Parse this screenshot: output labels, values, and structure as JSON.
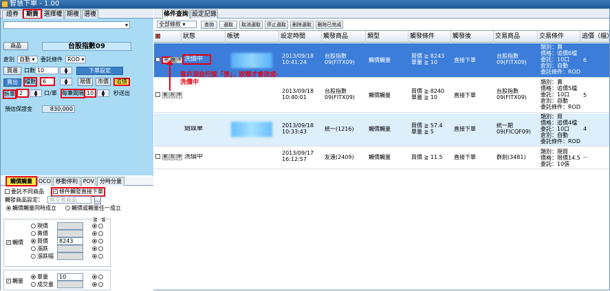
{
  "window": {
    "title": "智慧下單 - 1.00"
  },
  "left_tabs": [
    "證券",
    "期貨",
    "選擇權",
    "期複",
    "選複"
  ],
  "order": {
    "product_button": "商品",
    "product_name": "台股指數09",
    "position_label": "倉別",
    "position_value": "自動",
    "condition_label": "委託條件",
    "condition_value": "ROD",
    "buy_label": "買進",
    "lots_label": "口數",
    "lots_value": "10",
    "place_order": "下單設定",
    "sell_label": "賣出",
    "ticks_label": "檔數",
    "ticks_value": "6",
    "limit_btn": "限價",
    "market_btn": "市價",
    "chase_btn": "追價",
    "split_label": "拆單",
    "split_value": "2",
    "per_lot_label": "口/單",
    "interval_label": "每筆間隔",
    "interval_value": "10",
    "sec_label": "秒送出",
    "margin_label": "預估保證金",
    "margin_value": "830,000"
  },
  "cond_tabs": [
    "觸價觸量",
    "OCO",
    "移動停利",
    "POV",
    "分時分量"
  ],
  "cond": {
    "diff_product": "委託不同商品",
    "direct_order": "條件觸發直接下單",
    "trigger_product_label": "觸發商品設定：",
    "trigger_product_value": "與交易商品",
    "radio_all": "觸價觸量同時成立",
    "radio_any": "觸價或觸量任一成立",
    "price_check": "觸價",
    "price_opts": [
      "現價",
      "賣價",
      "買價",
      "漲跌",
      "漲跌幅"
    ],
    "price_value": "8243",
    "vol_check": "觸量",
    "vol_opts": [
      "單量",
      "成交量"
    ],
    "vol_value": "10",
    "ge": "≧",
    "le": "≦"
  },
  "right_tabs": [
    "條件查詢",
    "設定記錄"
  ],
  "toolbar": {
    "filter": "全部條款",
    "query": "查詢",
    "select": "選取",
    "cancel_select": "取消選取",
    "stop_select": "停止選取",
    "delete_select": "刪除選取",
    "delete_done": "刪除已完成"
  },
  "columns": [
    "狀態",
    "帳號",
    "設定時間",
    "觸發商品",
    "類型",
    "觸發條件",
    "觸發後",
    "交易商品",
    "交易條件",
    "追價（檔）"
  ],
  "rows": [
    {
      "status": "洗價中",
      "time": "2013/09/18 10:41:24",
      "trig_prod": "台股指數 09(FITX09)",
      "type": "觸價觸量",
      "cond": "買價 ≧ 8243\n單量 ≧ 10",
      "after": "直接下單",
      "trade_prod": "台股指數 09(FITX09)",
      "trade_cond": "類別：賣\n價格：追價6檔\n委託：10口\n倉別：自動\n委託條件：ROD",
      "chase": "6"
    },
    {
      "status": "",
      "time": "2013/09/18 10:40:01",
      "trig_prod": "台股指數 09(FITX09)",
      "type": "觸價觸量",
      "cond": "買價 ≧ 8240\n單量 ≧ 10",
      "after": "直接下單",
      "trade_prod": "台股指數 09(FITX09)",
      "trade_cond": "類別：賣\n價格：追價5檔\n委託：10口\n倉別：自動\n委託條件：ROD",
      "chase": "5"
    },
    {
      "status": "錯誤單",
      "time": "2013/09/18 10:33:43",
      "trig_prod": "統一(1216)",
      "type": "觸價觸量",
      "cond": "買價 ≧ 57.4\n單量 ≧ 5",
      "after": "直接下單",
      "trade_prod": "統一期 09(FICQF09)",
      "trade_cond": "類別：買\n價格：追價4檔\n委託：10口\n倉別：自動\n委託條件：ROD",
      "chase": "4"
    },
    {
      "status": "洗價中",
      "time": "2013/09/17 16:12:57",
      "trig_prod": "友達(2409)",
      "type": "觸價觸量",
      "cond": "買價 ≧ 11.5",
      "after": "直接下單",
      "trade_prod": "群創(3481)",
      "trade_cond": "類別：現買\n價格：限價14.5\n委託：10張",
      "chase": "--"
    }
  ],
  "row_icons": [
    "刪",
    "改",
    "停"
  ],
  "annotation": "客戶須自行按「啓」，狀態才會改成-洗價中"
}
